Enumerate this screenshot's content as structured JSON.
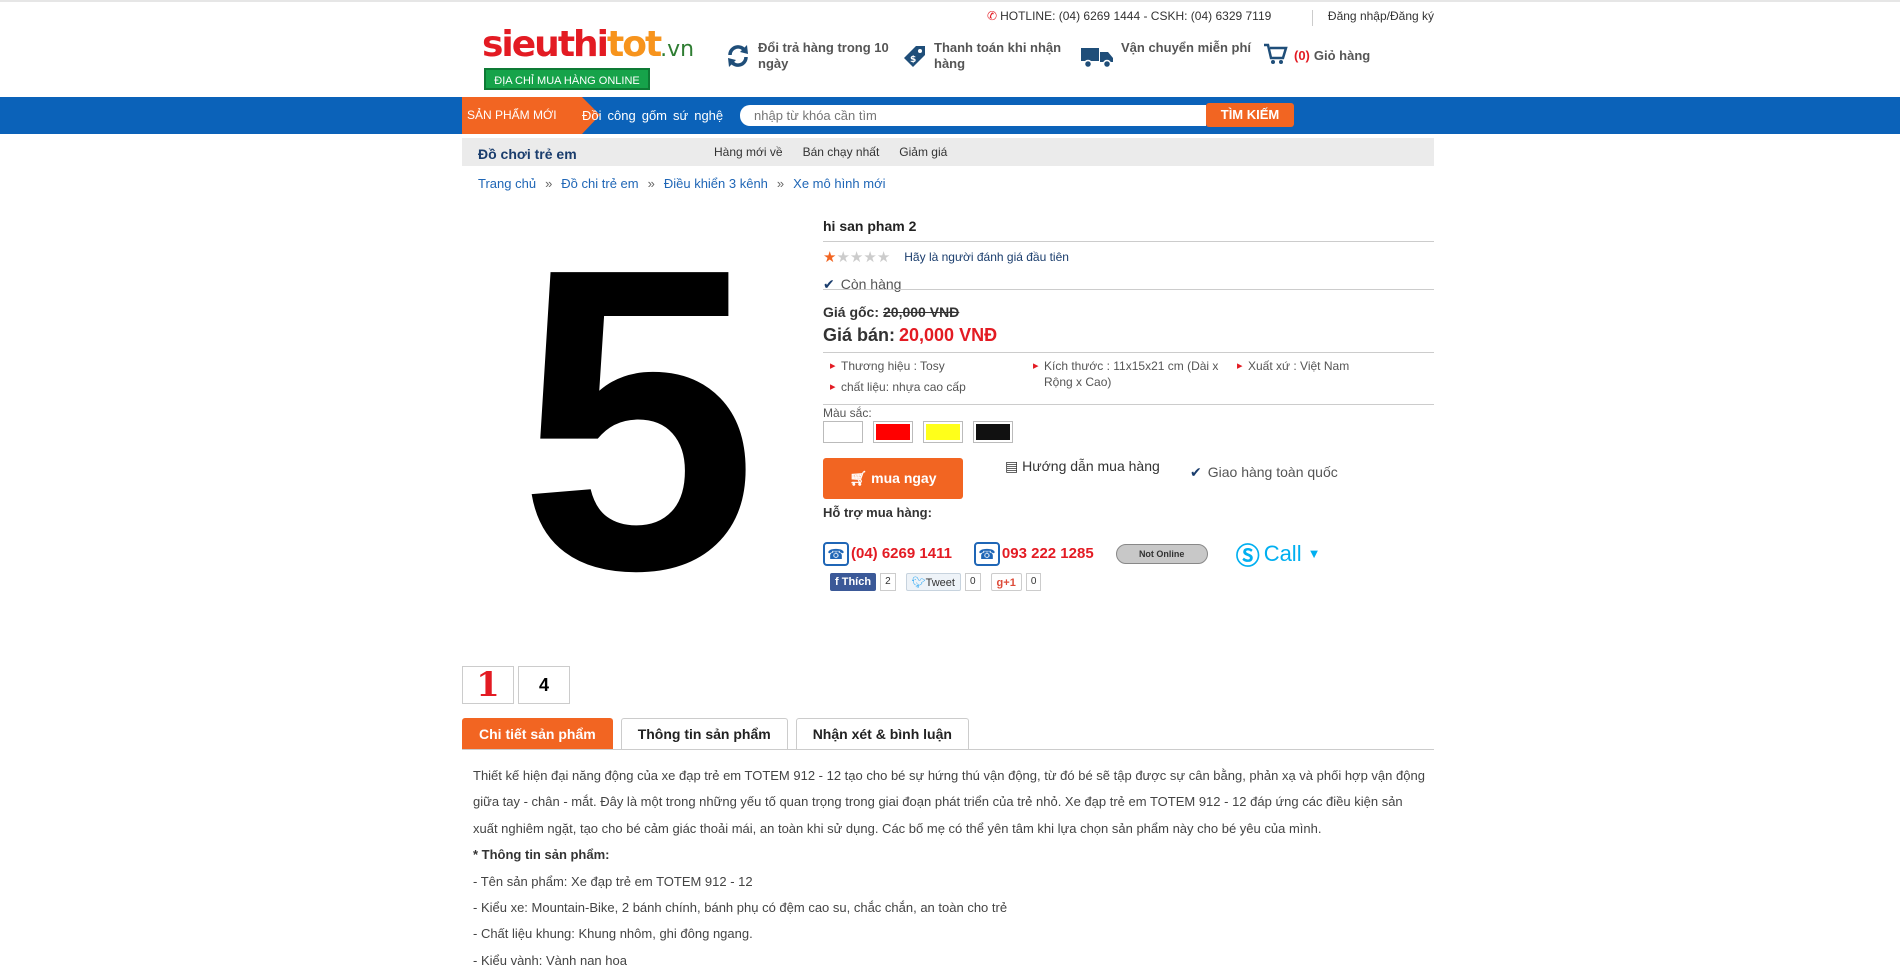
{
  "header": {
    "logo_part1": "sieuthi",
    "logo_part2": "tot",
    "logo_part3": ".vn",
    "logo_tagline": "ĐỊA CHỈ MUA HÀNG ONLINE",
    "hotline": "HOTLINE: (04) 6269 1444 - CSKH: (04) 6329 7119",
    "login": "Đăng nhập/Đăng ký",
    "features": [
      {
        "label": "Đổi trả hàng trong 10 ngày",
        "icon": "refresh-icon"
      },
      {
        "label": "Thanh toán khi nhận hàng",
        "icon": "price-tag-icon"
      },
      {
        "label": "Vận chuyển miễn phí",
        "icon": "delivery-truck-icon"
      }
    ],
    "cart_count": "(0)",
    "cart_label": "Giỏ hàng"
  },
  "nav": {
    "new_products": "SẢN PHẨM MỚI",
    "words": [
      "Đồi",
      "công",
      "gốm",
      "sứ",
      "nghệ"
    ],
    "search_placeholder": "nhập từ khóa cần tìm",
    "search_button": "TÌM KIẾM"
  },
  "category": {
    "title": "Đồ chơi trẻ em",
    "links": [
      "Hàng mới về",
      "Bán chạy nhất",
      "Giảm giá"
    ]
  },
  "breadcrumb": [
    "Trang chủ",
    "Đồ chi trẻ em",
    "Điều khiển 3 kênh",
    "Xe mô hình mới"
  ],
  "breadcrumb_sep": "»",
  "product": {
    "main_image_digit": "5",
    "thumbnails": [
      "1",
      "4"
    ],
    "title": "hi san pham 2",
    "rating": 1,
    "rating_max": 5,
    "rating_text": "Hãy là người đánh giá đầu tiên",
    "stock": "Còn hàng",
    "original_price_label": "Giá gốc:",
    "original_price": "20,000 VNĐ",
    "sale_price_label": "Giá bán:",
    "sale_price": "20,000 VNĐ",
    "attributes": {
      "brand": "Thương hiệu : Tosy",
      "size": "Kích thước : 11x15x21 cm (Dài x Rộng x Cao)",
      "origin": "Xuất xứ : Việt Nam",
      "material": "chất liệu: nhựa cao cấp"
    },
    "colors_label": "Màu sắc:",
    "colors": [
      "#ffffff",
      "#ff0000",
      "#ffff1a",
      "#111111"
    ],
    "buy_button": "mua ngay",
    "guide": "Hướng dẫn mua hàng",
    "shipping": "Giao hàng toàn quốc",
    "support_label": "Hỗ trợ mua hàng:",
    "phone1": "(04) 6269 1411",
    "phone2": "093 222 1285",
    "online_status": "Not Online",
    "skype_label": "Call",
    "social": {
      "fb_label": "Thích",
      "fb_count": "2",
      "tw_label": "Tweet",
      "tw_count": "0",
      "gp_label": "+1",
      "gp_count": "0"
    }
  },
  "tabs": [
    "Chi tiết sản phẩm",
    "Thông tin sản phẩm",
    "Nhận xét & bình luận"
  ],
  "description": {
    "intro": "Thiết kế hiện đại năng động của xe đạp trẻ em TOTEM 912 - 12 tạo cho bé sự hứng thú vận động, từ đó bé sẽ tập được sự cân bằng, phản xạ và phối hợp vận động giữa tay - chân - mắt. Đây là một trong những yếu tố quan trọng trong giai đoạn phát triển của trẻ nhỏ. Xe đạp trẻ em TOTEM 912 - 12 đáp ứng các điều kiện sản xuất nghiêm ngặt, tạo cho bé cảm giác thoải mái, an toàn khi sử dụng. Các bố mẹ có thể yên tâm khi lựa chọn sản phẩm này cho bé yêu của mình.",
    "heading": "* Thông tin sản phẩm:",
    "lines": [
      "- Tên sản phẩm: Xe đạp trẻ em TOTEM 912 - 12",
      "- Kiểu xe: Mountain-Bike, 2 bánh chính, bánh phụ có đệm cao su, chắc chắn, an toàn cho trẻ",
      "- Chất liệu khung: Khung nhôm, ghi đông ngang.",
      "- Kiểu vành: Vành nan hoa"
    ]
  }
}
